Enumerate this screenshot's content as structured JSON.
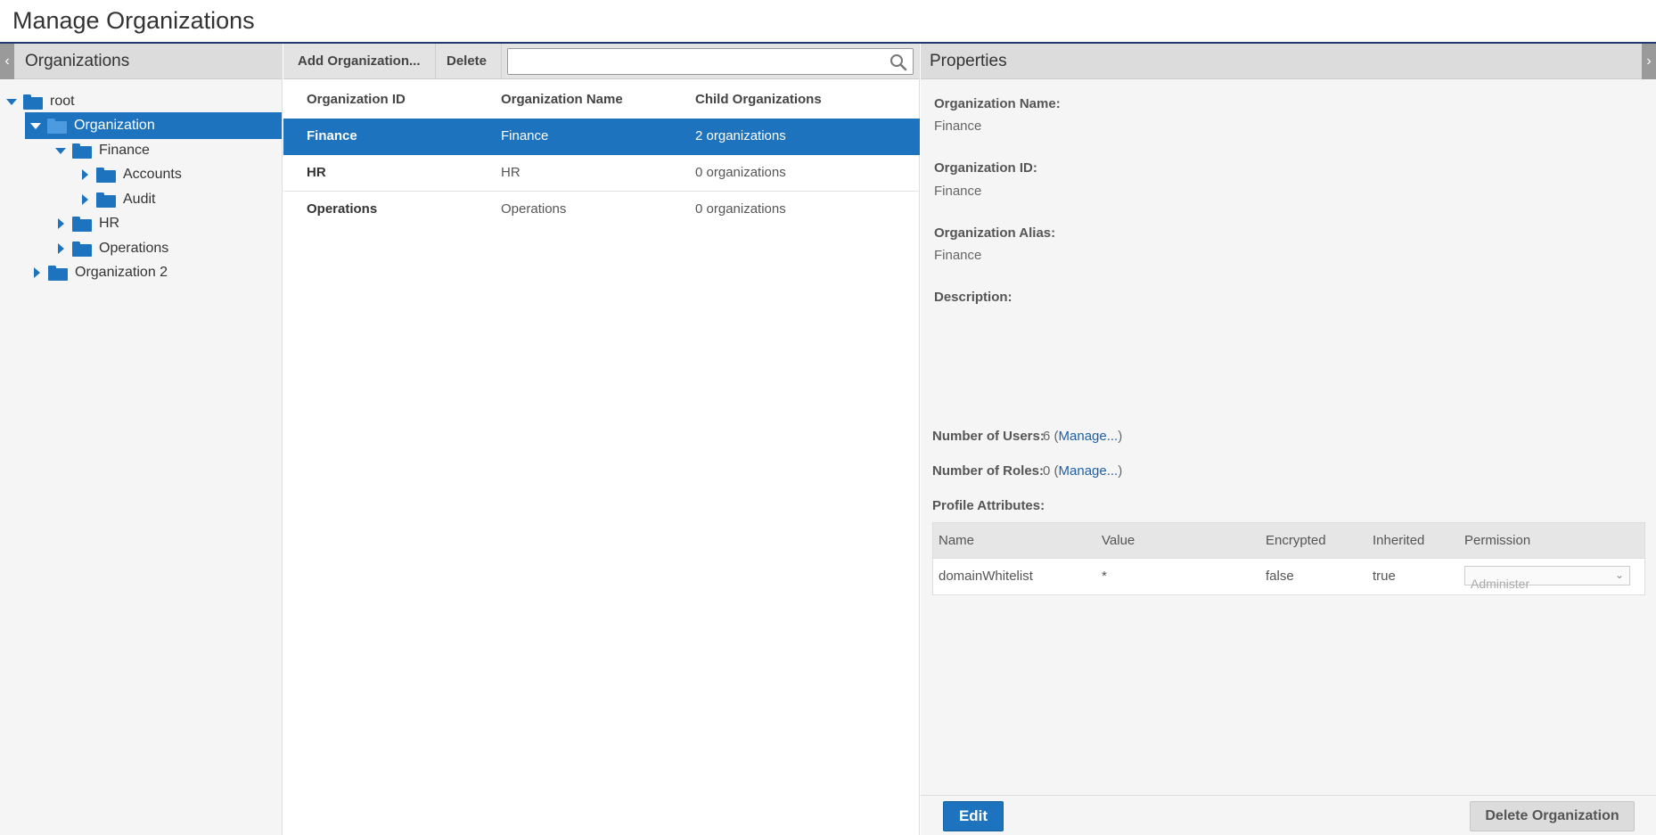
{
  "page": {
    "title": "Manage Organizations"
  },
  "left_panel": {
    "header": "Organizations",
    "tree": [
      {
        "label": "root",
        "expanded": true,
        "selected": false
      },
      {
        "label": "Organization",
        "expanded": true,
        "selected": true
      },
      {
        "label": "Finance",
        "expanded": true,
        "selected": false
      },
      {
        "label": "Accounts",
        "expanded": false,
        "selected": false
      },
      {
        "label": "Audit",
        "expanded": false,
        "selected": false
      },
      {
        "label": "HR",
        "expanded": false,
        "selected": false
      },
      {
        "label": "Operations",
        "expanded": false,
        "selected": false
      },
      {
        "label": "Organization 2",
        "expanded": false,
        "selected": false
      }
    ]
  },
  "toolbar": {
    "add_label": "Add Organization...",
    "delete_label": "Delete",
    "search_placeholder": ""
  },
  "grid": {
    "columns": [
      "Organization ID",
      "Organization Name",
      "Child Organizations"
    ],
    "rows": [
      {
        "id": "Finance",
        "name": "Finance",
        "children": "2 organizations",
        "selected": true
      },
      {
        "id": "HR",
        "name": "HR",
        "children": "0 organizations",
        "selected": false
      },
      {
        "id": "Operations",
        "name": "Operations",
        "children": "0 organizations",
        "selected": false
      }
    ]
  },
  "properties": {
    "header": "Properties",
    "org_name_label": "Organization Name:",
    "org_name_value": "Finance",
    "org_id_label": "Organization ID:",
    "org_id_value": "Finance",
    "org_alias_label": "Organization Alias:",
    "org_alias_value": "Finance",
    "description_label": "Description:",
    "users_label": "Number of Users:",
    "users_value": "6",
    "roles_label": "Number of Roles:",
    "roles_value": "0",
    "manage_link": "Manage...",
    "profile_label": "Profile Attributes:",
    "attr_columns": [
      "Name",
      "Value",
      "Encrypted",
      "Inherited",
      "Permission"
    ],
    "attr_rows": [
      {
        "name": "domainWhitelist",
        "value": "*",
        "encrypted": "false",
        "inherited": "true",
        "permission": "Administer"
      }
    ]
  },
  "footer": {
    "edit_label": "Edit",
    "delete_label": "Delete Organization"
  },
  "colors": {
    "accent": "#1e73be",
    "title_rule": "#1f3a6e",
    "link": "#1f5fa6"
  },
  "icons": {
    "tree_folder": "folder-icon",
    "expanded": "triangle-down-icon",
    "collapsed": "triangle-right-icon",
    "search": "search-icon",
    "collapse_left": "chevron-left-icon",
    "collapse_right": "chevron-right-icon"
  }
}
